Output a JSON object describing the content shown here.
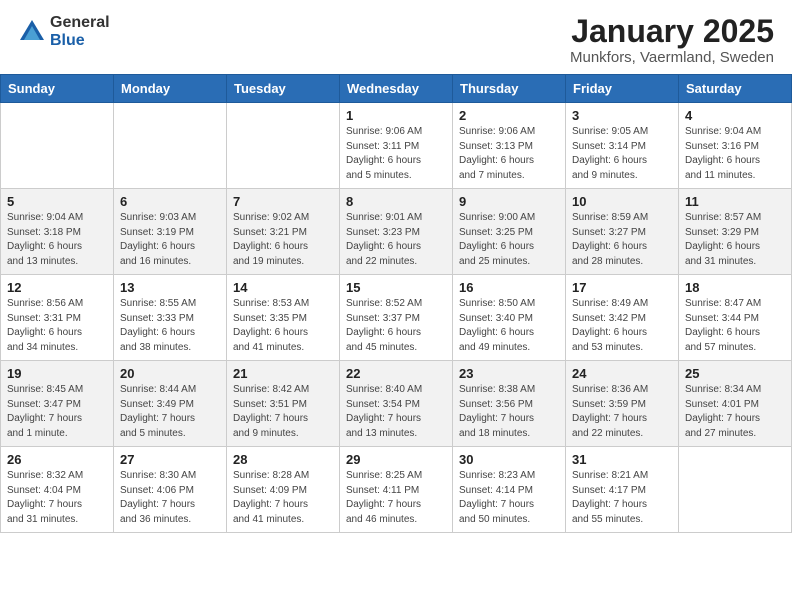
{
  "header": {
    "logo_general": "General",
    "logo_blue": "Blue",
    "month_title": "January 2025",
    "location": "Munkfors, Vaermland, Sweden"
  },
  "days_of_week": [
    "Sunday",
    "Monday",
    "Tuesday",
    "Wednesday",
    "Thursday",
    "Friday",
    "Saturday"
  ],
  "weeks": [
    [
      {
        "day": "",
        "info": ""
      },
      {
        "day": "",
        "info": ""
      },
      {
        "day": "",
        "info": ""
      },
      {
        "day": "1",
        "info": "Sunrise: 9:06 AM\nSunset: 3:11 PM\nDaylight: 6 hours\nand 5 minutes."
      },
      {
        "day": "2",
        "info": "Sunrise: 9:06 AM\nSunset: 3:13 PM\nDaylight: 6 hours\nand 7 minutes."
      },
      {
        "day": "3",
        "info": "Sunrise: 9:05 AM\nSunset: 3:14 PM\nDaylight: 6 hours\nand 9 minutes."
      },
      {
        "day": "4",
        "info": "Sunrise: 9:04 AM\nSunset: 3:16 PM\nDaylight: 6 hours\nand 11 minutes."
      }
    ],
    [
      {
        "day": "5",
        "info": "Sunrise: 9:04 AM\nSunset: 3:18 PM\nDaylight: 6 hours\nand 13 minutes."
      },
      {
        "day": "6",
        "info": "Sunrise: 9:03 AM\nSunset: 3:19 PM\nDaylight: 6 hours\nand 16 minutes."
      },
      {
        "day": "7",
        "info": "Sunrise: 9:02 AM\nSunset: 3:21 PM\nDaylight: 6 hours\nand 19 minutes."
      },
      {
        "day": "8",
        "info": "Sunrise: 9:01 AM\nSunset: 3:23 PM\nDaylight: 6 hours\nand 22 minutes."
      },
      {
        "day": "9",
        "info": "Sunrise: 9:00 AM\nSunset: 3:25 PM\nDaylight: 6 hours\nand 25 minutes."
      },
      {
        "day": "10",
        "info": "Sunrise: 8:59 AM\nSunset: 3:27 PM\nDaylight: 6 hours\nand 28 minutes."
      },
      {
        "day": "11",
        "info": "Sunrise: 8:57 AM\nSunset: 3:29 PM\nDaylight: 6 hours\nand 31 minutes."
      }
    ],
    [
      {
        "day": "12",
        "info": "Sunrise: 8:56 AM\nSunset: 3:31 PM\nDaylight: 6 hours\nand 34 minutes."
      },
      {
        "day": "13",
        "info": "Sunrise: 8:55 AM\nSunset: 3:33 PM\nDaylight: 6 hours\nand 38 minutes."
      },
      {
        "day": "14",
        "info": "Sunrise: 8:53 AM\nSunset: 3:35 PM\nDaylight: 6 hours\nand 41 minutes."
      },
      {
        "day": "15",
        "info": "Sunrise: 8:52 AM\nSunset: 3:37 PM\nDaylight: 6 hours\nand 45 minutes."
      },
      {
        "day": "16",
        "info": "Sunrise: 8:50 AM\nSunset: 3:40 PM\nDaylight: 6 hours\nand 49 minutes."
      },
      {
        "day": "17",
        "info": "Sunrise: 8:49 AM\nSunset: 3:42 PM\nDaylight: 6 hours\nand 53 minutes."
      },
      {
        "day": "18",
        "info": "Sunrise: 8:47 AM\nSunset: 3:44 PM\nDaylight: 6 hours\nand 57 minutes."
      }
    ],
    [
      {
        "day": "19",
        "info": "Sunrise: 8:45 AM\nSunset: 3:47 PM\nDaylight: 7 hours\nand 1 minute."
      },
      {
        "day": "20",
        "info": "Sunrise: 8:44 AM\nSunset: 3:49 PM\nDaylight: 7 hours\nand 5 minutes."
      },
      {
        "day": "21",
        "info": "Sunrise: 8:42 AM\nSunset: 3:51 PM\nDaylight: 7 hours\nand 9 minutes."
      },
      {
        "day": "22",
        "info": "Sunrise: 8:40 AM\nSunset: 3:54 PM\nDaylight: 7 hours\nand 13 minutes."
      },
      {
        "day": "23",
        "info": "Sunrise: 8:38 AM\nSunset: 3:56 PM\nDaylight: 7 hours\nand 18 minutes."
      },
      {
        "day": "24",
        "info": "Sunrise: 8:36 AM\nSunset: 3:59 PM\nDaylight: 7 hours\nand 22 minutes."
      },
      {
        "day": "25",
        "info": "Sunrise: 8:34 AM\nSunset: 4:01 PM\nDaylight: 7 hours\nand 27 minutes."
      }
    ],
    [
      {
        "day": "26",
        "info": "Sunrise: 8:32 AM\nSunset: 4:04 PM\nDaylight: 7 hours\nand 31 minutes."
      },
      {
        "day": "27",
        "info": "Sunrise: 8:30 AM\nSunset: 4:06 PM\nDaylight: 7 hours\nand 36 minutes."
      },
      {
        "day": "28",
        "info": "Sunrise: 8:28 AM\nSunset: 4:09 PM\nDaylight: 7 hours\nand 41 minutes."
      },
      {
        "day": "29",
        "info": "Sunrise: 8:25 AM\nSunset: 4:11 PM\nDaylight: 7 hours\nand 46 minutes."
      },
      {
        "day": "30",
        "info": "Sunrise: 8:23 AM\nSunset: 4:14 PM\nDaylight: 7 hours\nand 50 minutes."
      },
      {
        "day": "31",
        "info": "Sunrise: 8:21 AM\nSunset: 4:17 PM\nDaylight: 7 hours\nand 55 minutes."
      },
      {
        "day": "",
        "info": ""
      }
    ]
  ]
}
